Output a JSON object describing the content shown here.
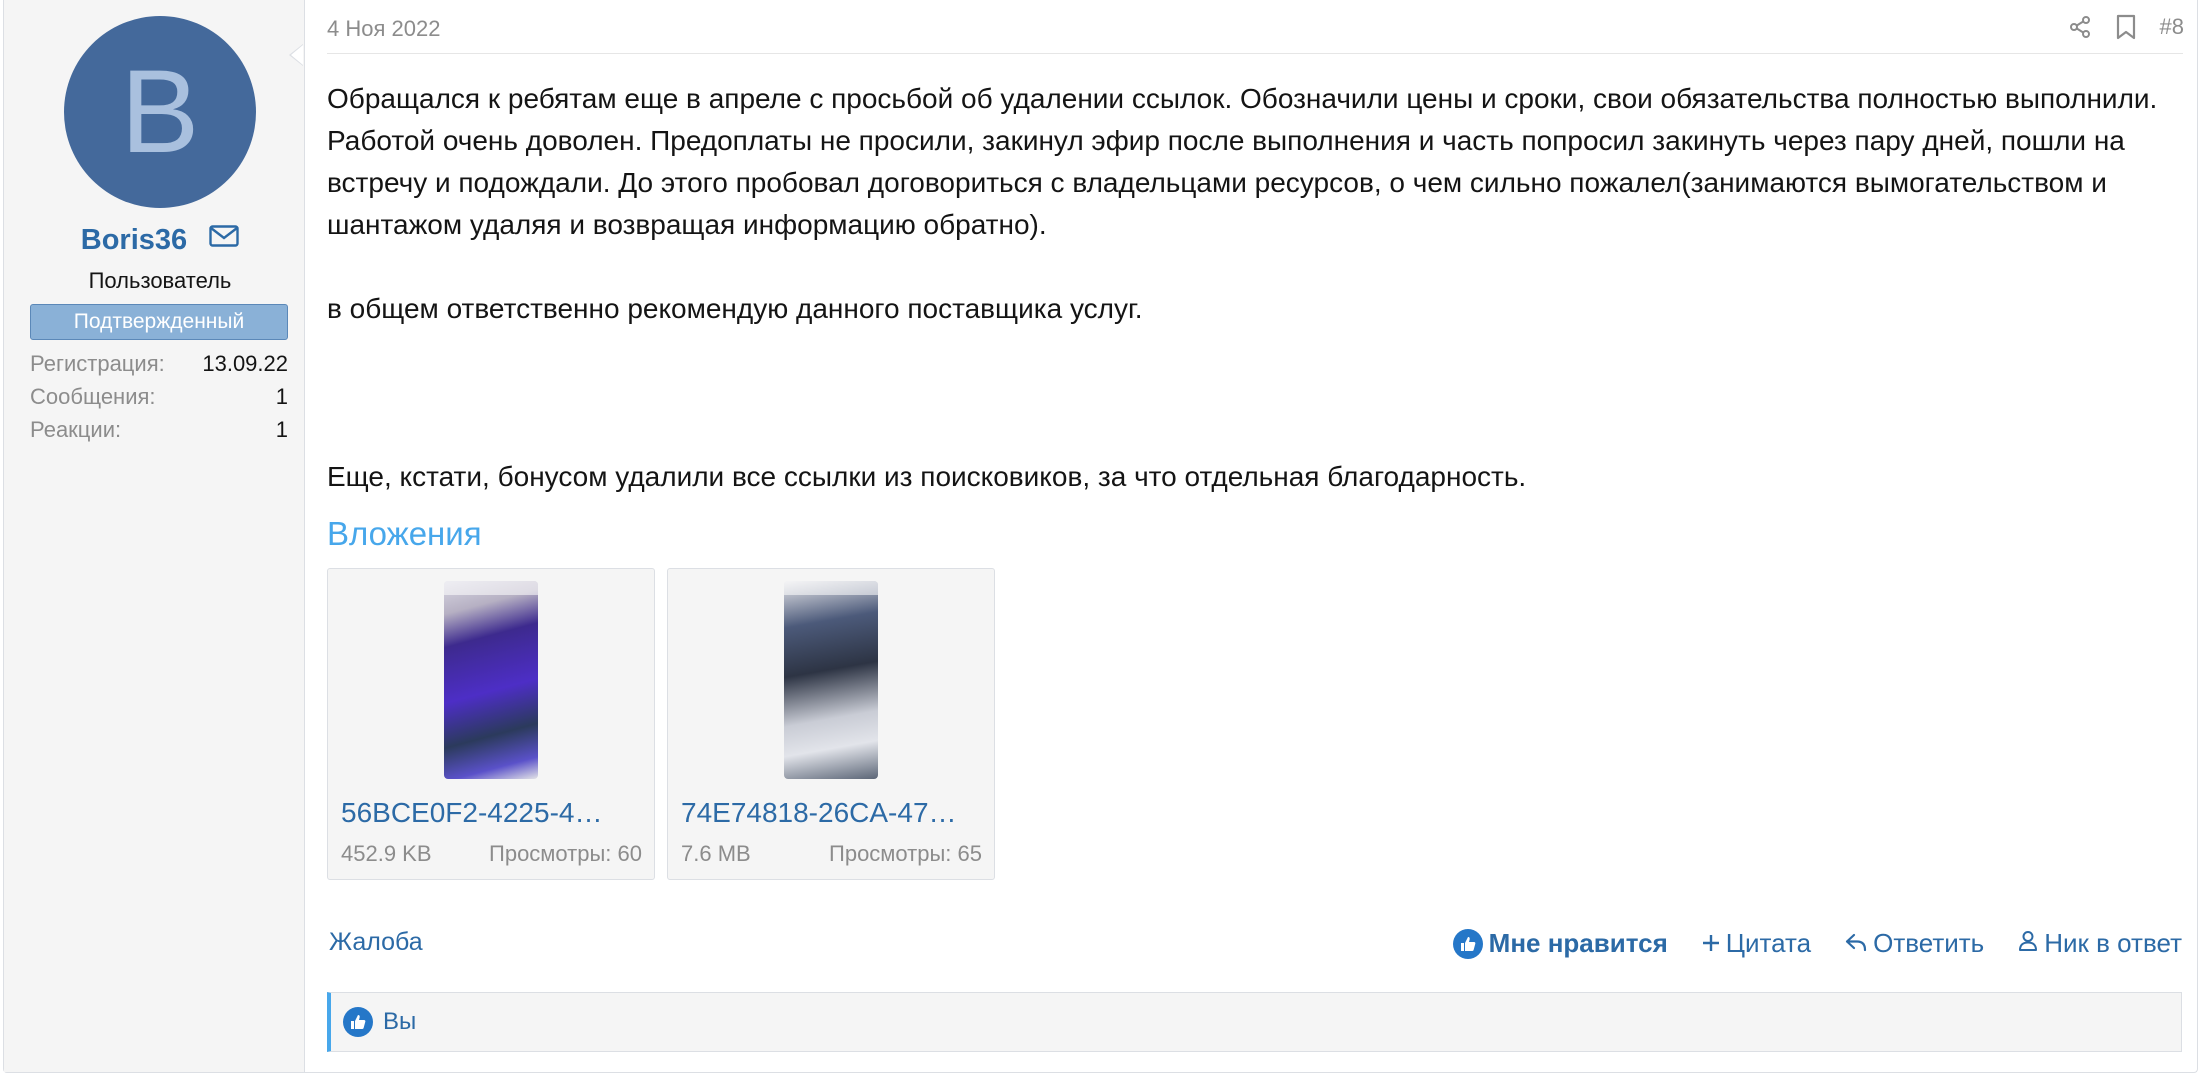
{
  "user": {
    "avatar_letter": "B",
    "name": "Boris36",
    "title": "Пользователь",
    "banner": "Подтвержденный",
    "stats": [
      {
        "label": "Регистрация:",
        "value": "13.09.22"
      },
      {
        "label": "Сообщения:",
        "value": "1"
      },
      {
        "label": "Реакции:",
        "value": "1"
      }
    ]
  },
  "post": {
    "date": "4 Ноя 2022",
    "number": "#8",
    "paragraphs": [
      "Обращался к ребятам еще в апреле с просьбой об удалении ссылок. Обозначили цены и сроки, свои обязательства полностью выполнили. Работой очень доволен. Предоплаты не просили, закинул эфир после выполнения и часть попросил закинуть через пару дней, пошли на встречу и подождали. До этого пробовал договориться с владельцами ресурсов, о чем сильно пожалел(занимаются вымогательством и шантажом удаляя и возвращая информацию обратно).",
      "в общем ответственно рекомендую данного поставщика услуг.",
      "Еще, кстати, бонусом удалили все ссылки из поисковиков, за что отдельная благодарность."
    ],
    "attachments_title": "Вложения",
    "attachments": [
      {
        "name": "56BCE0F2-4225-4…",
        "size": "452.9 KB",
        "views": "Просмотры: 60"
      },
      {
        "name": "74E74818-26CA-47…",
        "size": "7.6 MB",
        "views": "Просмотры: 65"
      }
    ]
  },
  "footer": {
    "report": "Жалоба",
    "like": "Мне нравится",
    "quote": "Цитата",
    "reply": "Ответить",
    "mention": "Ник в ответ"
  },
  "reactions": {
    "who": "Вы"
  },
  "colors": {
    "link": "#2c6aa6",
    "accent": "#47a7eb",
    "avatar_bg": "#44699b",
    "banner_bg": "#8ab1d7",
    "sidebar_bg": "#f5f5f5"
  }
}
